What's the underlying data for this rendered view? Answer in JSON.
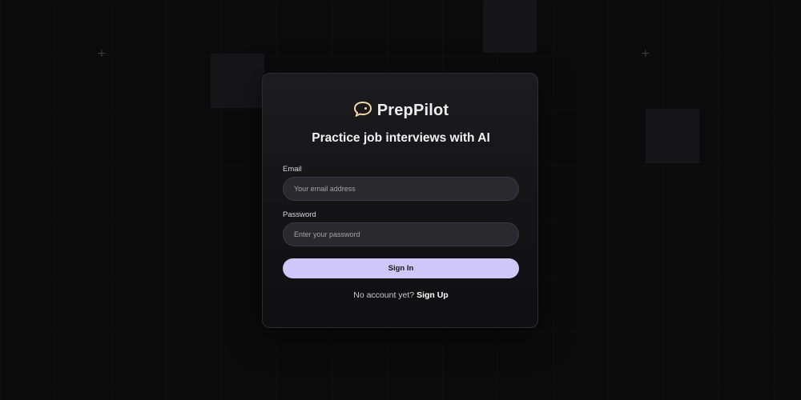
{
  "brand": {
    "name": "PrepPilot",
    "logo_icon": "speech-bubble-icon"
  },
  "tagline": "Practice job interviews with AI",
  "form": {
    "email_label": "Email",
    "email_placeholder": "Your email address",
    "password_label": "Password",
    "password_placeholder": "Enter your password",
    "submit_label": "Sign In"
  },
  "footer": {
    "prompt": "No account yet?",
    "link_label": "Sign Up"
  },
  "colors": {
    "accent": "#cfc7f7",
    "background": "#0b0b0c",
    "card": "#161618"
  }
}
